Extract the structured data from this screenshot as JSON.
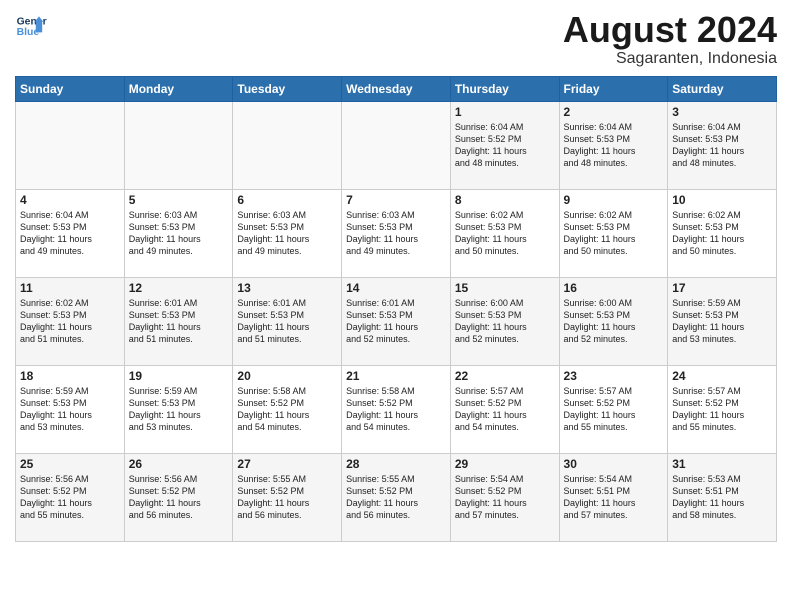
{
  "logo": {
    "line1": "General",
    "line2": "Blue"
  },
  "title": "August 2024",
  "subtitle": "Sagaranten, Indonesia",
  "days": [
    "Sunday",
    "Monday",
    "Tuesday",
    "Wednesday",
    "Thursday",
    "Friday",
    "Saturday"
  ],
  "weeks": [
    [
      {
        "day": "",
        "text": ""
      },
      {
        "day": "",
        "text": ""
      },
      {
        "day": "",
        "text": ""
      },
      {
        "day": "",
        "text": ""
      },
      {
        "day": "1",
        "text": "Sunrise: 6:04 AM\nSunset: 5:52 PM\nDaylight: 11 hours\nand 48 minutes."
      },
      {
        "day": "2",
        "text": "Sunrise: 6:04 AM\nSunset: 5:53 PM\nDaylight: 11 hours\nand 48 minutes."
      },
      {
        "day": "3",
        "text": "Sunrise: 6:04 AM\nSunset: 5:53 PM\nDaylight: 11 hours\nand 48 minutes."
      }
    ],
    [
      {
        "day": "4",
        "text": "Sunrise: 6:04 AM\nSunset: 5:53 PM\nDaylight: 11 hours\nand 49 minutes."
      },
      {
        "day": "5",
        "text": "Sunrise: 6:03 AM\nSunset: 5:53 PM\nDaylight: 11 hours\nand 49 minutes."
      },
      {
        "day": "6",
        "text": "Sunrise: 6:03 AM\nSunset: 5:53 PM\nDaylight: 11 hours\nand 49 minutes."
      },
      {
        "day": "7",
        "text": "Sunrise: 6:03 AM\nSunset: 5:53 PM\nDaylight: 11 hours\nand 49 minutes."
      },
      {
        "day": "8",
        "text": "Sunrise: 6:02 AM\nSunset: 5:53 PM\nDaylight: 11 hours\nand 50 minutes."
      },
      {
        "day": "9",
        "text": "Sunrise: 6:02 AM\nSunset: 5:53 PM\nDaylight: 11 hours\nand 50 minutes."
      },
      {
        "day": "10",
        "text": "Sunrise: 6:02 AM\nSunset: 5:53 PM\nDaylight: 11 hours\nand 50 minutes."
      }
    ],
    [
      {
        "day": "11",
        "text": "Sunrise: 6:02 AM\nSunset: 5:53 PM\nDaylight: 11 hours\nand 51 minutes."
      },
      {
        "day": "12",
        "text": "Sunrise: 6:01 AM\nSunset: 5:53 PM\nDaylight: 11 hours\nand 51 minutes."
      },
      {
        "day": "13",
        "text": "Sunrise: 6:01 AM\nSunset: 5:53 PM\nDaylight: 11 hours\nand 51 minutes."
      },
      {
        "day": "14",
        "text": "Sunrise: 6:01 AM\nSunset: 5:53 PM\nDaylight: 11 hours\nand 52 minutes."
      },
      {
        "day": "15",
        "text": "Sunrise: 6:00 AM\nSunset: 5:53 PM\nDaylight: 11 hours\nand 52 minutes."
      },
      {
        "day": "16",
        "text": "Sunrise: 6:00 AM\nSunset: 5:53 PM\nDaylight: 11 hours\nand 52 minutes."
      },
      {
        "day": "17",
        "text": "Sunrise: 5:59 AM\nSunset: 5:53 PM\nDaylight: 11 hours\nand 53 minutes."
      }
    ],
    [
      {
        "day": "18",
        "text": "Sunrise: 5:59 AM\nSunset: 5:53 PM\nDaylight: 11 hours\nand 53 minutes."
      },
      {
        "day": "19",
        "text": "Sunrise: 5:59 AM\nSunset: 5:53 PM\nDaylight: 11 hours\nand 53 minutes."
      },
      {
        "day": "20",
        "text": "Sunrise: 5:58 AM\nSunset: 5:52 PM\nDaylight: 11 hours\nand 54 minutes."
      },
      {
        "day": "21",
        "text": "Sunrise: 5:58 AM\nSunset: 5:52 PM\nDaylight: 11 hours\nand 54 minutes."
      },
      {
        "day": "22",
        "text": "Sunrise: 5:57 AM\nSunset: 5:52 PM\nDaylight: 11 hours\nand 54 minutes."
      },
      {
        "day": "23",
        "text": "Sunrise: 5:57 AM\nSunset: 5:52 PM\nDaylight: 11 hours\nand 55 minutes."
      },
      {
        "day": "24",
        "text": "Sunrise: 5:57 AM\nSunset: 5:52 PM\nDaylight: 11 hours\nand 55 minutes."
      }
    ],
    [
      {
        "day": "25",
        "text": "Sunrise: 5:56 AM\nSunset: 5:52 PM\nDaylight: 11 hours\nand 55 minutes."
      },
      {
        "day": "26",
        "text": "Sunrise: 5:56 AM\nSunset: 5:52 PM\nDaylight: 11 hours\nand 56 minutes."
      },
      {
        "day": "27",
        "text": "Sunrise: 5:55 AM\nSunset: 5:52 PM\nDaylight: 11 hours\nand 56 minutes."
      },
      {
        "day": "28",
        "text": "Sunrise: 5:55 AM\nSunset: 5:52 PM\nDaylight: 11 hours\nand 56 minutes."
      },
      {
        "day": "29",
        "text": "Sunrise: 5:54 AM\nSunset: 5:52 PM\nDaylight: 11 hours\nand 57 minutes."
      },
      {
        "day": "30",
        "text": "Sunrise: 5:54 AM\nSunset: 5:51 PM\nDaylight: 11 hours\nand 57 minutes."
      },
      {
        "day": "31",
        "text": "Sunrise: 5:53 AM\nSunset: 5:51 PM\nDaylight: 11 hours\nand 58 minutes."
      }
    ]
  ]
}
